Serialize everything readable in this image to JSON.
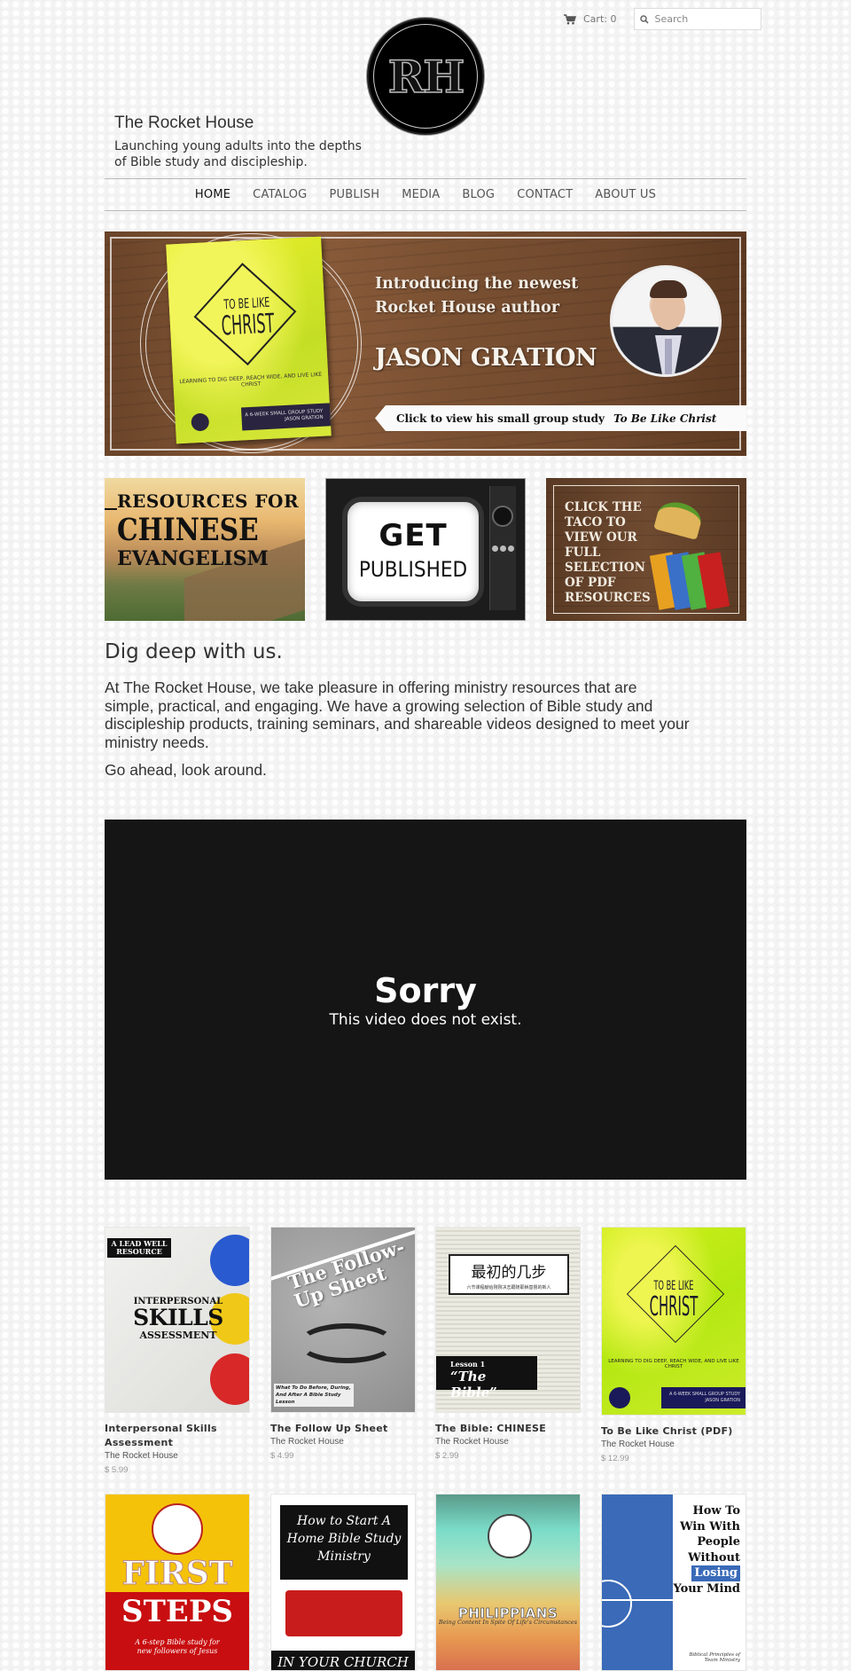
{
  "header": {
    "cart_label": "Cart: 0",
    "search_placeholder": "Search",
    "logo_text": "RH",
    "site_title": "The Rocket House",
    "tagline": "Launching young adults into the depths of Bible study and discipleship."
  },
  "nav": {
    "items": [
      {
        "label": "HOME",
        "active": true
      },
      {
        "label": "CATALOG",
        "active": false
      },
      {
        "label": "PUBLISH",
        "active": false
      },
      {
        "label": "MEDIA",
        "active": false
      },
      {
        "label": "BLOG",
        "active": false
      },
      {
        "label": "CONTACT",
        "active": false
      },
      {
        "label": "ABOUT US",
        "active": false
      }
    ]
  },
  "hero": {
    "intro_line1": "Introducing the newest",
    "intro_line2": "Rocket House author",
    "author": "JASON GRATION",
    "cta_prefix": "Click to view his small group study",
    "cta_title": "To Be Like Christ",
    "book_title_top": "TO BE LIKE",
    "book_title_main": "CHRIST",
    "book_subtitle": "LEARNING TO DIG DEEP, REACH WIDE, AND LIVE LIKE CHRIST",
    "book_badge": "A 6-WEEK SMALL GROUP STUDY JASON GRATION"
  },
  "tiles": [
    {
      "line1": "RESOURCES FOR",
      "line2": "CHINESE",
      "line3": "EVANGELISM"
    },
    {
      "line1": "GET",
      "line2": "PUBLISHED"
    },
    {
      "text": "CLICK THE TACO TO VIEW OUR FULL SELECTION OF PDF RESOURCES"
    }
  ],
  "intro": {
    "heading": "Dig deep with us.",
    "paragraph": "At The Rocket House, we take pleasure in offering ministry resources that are simple, practical, and engaging. We have a growing selection of Bible study and discipleship products, training seminars, and shareable videos designed to meet your ministry needs.",
    "paragraph2": "Go ahead, look around."
  },
  "video": {
    "title": "Sorry",
    "message": "This video does not exist."
  },
  "products": [
    {
      "name": "Interpersonal Skills Assessment",
      "vendor": "The Rocket House",
      "price": "$ 5.99",
      "cover": {
        "tag": "A LEAD WELL RESOURCE",
        "a": "INTERPERSONAL",
        "b": "SKILLS",
        "c": "ASSESSMENT"
      }
    },
    {
      "name": "The Follow Up Sheet",
      "vendor": "The Rocket House",
      "price": "$ 4.99",
      "cover": {
        "title": "The Follow-Up Sheet",
        "sub": "What To Do Before, During, And After A Bible Study Lesson"
      }
    },
    {
      "name": "The Bible: CHINESE",
      "vendor": "The Rocket House",
      "price": "$ 2.99",
      "cover": {
        "zh": "最初的几步",
        "zh_sub": "六节课程献给刚刚决志跟随耶稣基督的新人",
        "l1": "Lesson 1",
        "l2": "“The Bible”"
      }
    },
    {
      "name": "To Be Like Christ (PDF)",
      "vendor": "The Rocket House",
      "price": "$ 12.99",
      "cover": {
        "a": "TO BE LIKE",
        "b": "CHRIST",
        "sub": "LEARNING TO DIG DEEP, REACH WIDE, AND LIVE LIKE CHRIST",
        "bar": "A 6-WEEK SMALL GROUP STUDY JASON GRATION"
      }
    },
    {
      "cover": {
        "t1": "FIRST",
        "t2": "STEPS",
        "t3": "A 6-step Bible study for new followers of Jesus"
      }
    },
    {
      "cover": {
        "t1": "How to Start A Home Bible Study Ministry",
        "t2": "IN YOUR CHURCH"
      }
    },
    {
      "cover": {
        "t1": "PHILIPPIANS",
        "t2": "Being Content In Spite Of Life's Circumstances"
      }
    },
    {
      "cover": {
        "a": "How To Win With People Without",
        "hl": "Losing",
        "b": "Your Mind",
        "sub": "Biblical Principles of Team Ministry"
      }
    }
  ],
  "colors": {
    "page_bg": "#f3f3f3",
    "text": "#333333",
    "nav_active": "#111111",
    "video_bg": "#151515",
    "price": "#999999"
  }
}
